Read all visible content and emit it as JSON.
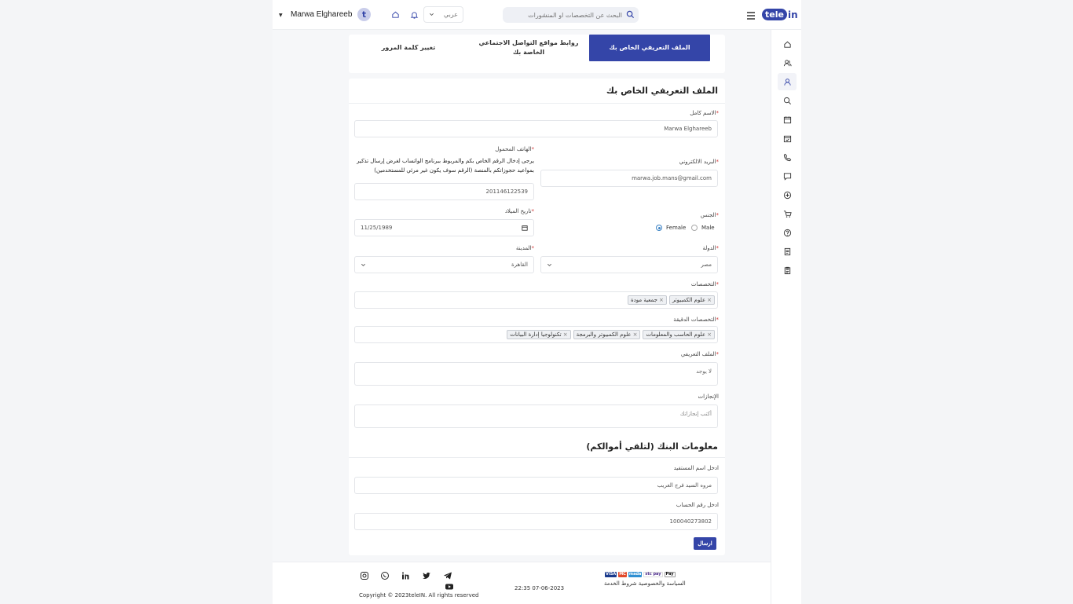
{
  "header": {
    "logo_tele": "tele",
    "logo_in": "in",
    "search_placeholder": "البحث عن التخصصات او المنشورات",
    "language": "عربي",
    "avatar_letter": "t",
    "username": "Marwa Elghareeb"
  },
  "tabs": [
    {
      "label": "الملف التعريفي الخاص بك",
      "active": true
    },
    {
      "label": "روابط مواقع التواصل الاجتماعي الخاصة بك",
      "active": false
    },
    {
      "label": "تغيير كلمة المرور",
      "active": false
    }
  ],
  "profile": {
    "title": "الملف التعريفي الخاص بك",
    "full_name_label": "الاسم كامل",
    "full_name": "Marwa Elghareeb",
    "mobile_label": "الهاتف المحمول",
    "mobile_note": "يرجى إدخال الرقم الخاص بكم والمربوط ببرنامج الواتساب لغرض إرسال تذكير بمواعيد حجوزاتكم بالمنصة (الرقم سوف يكون غير مرئي للمستخدمين)",
    "mobile": "201146122539",
    "email_label": "البريد الالكتروني",
    "email": "marwa.job.mans@gmail.com",
    "birthdate_label": "تاريخ الميلاد",
    "birthdate": "11/25/1989",
    "gender_label": "الجنس",
    "gender_female": "Female",
    "gender_male": "Male",
    "gender_selected": "Female",
    "city_label": "المدينة",
    "city": "القاهرة",
    "country_label": "الدولة",
    "country": "مصر",
    "specialties_label": "التخصصات",
    "specialties": [
      "علوم الكمبيوتر",
      "جمعية مودة"
    ],
    "sub_specialties_label": "التخصصات الدقيقة",
    "sub_specialties": [
      "علوم الحاسب والمعلومات",
      "علوم الكمبيوتر والبرمجة",
      "تكنولوجيا إدارة البيانات"
    ],
    "bio_label": "الملف التعريفي",
    "bio": "لا يوجد",
    "achievements_label": "الإنجازات",
    "achievements_placeholder": "أكتب إنجازاتك"
  },
  "bank": {
    "title": "معلومات البنك (لتلقي أموالكم)",
    "beneficiary_label": "ادخل اسم المستفيد",
    "beneficiary": "مروه السيد فرج الغريب",
    "account_label": "ادخل رقم الحساب",
    "account": "100040273802",
    "submit": "ارسال"
  },
  "footer": {
    "copyright": "Copyright © 2023teleIN. All rights reserved",
    "datetime": "22:35 07-06-2023",
    "policy": "السياسة والخصوصية شروط الخدمة",
    "payments": [
      "VISA",
      "MC",
      "mada",
      "stc pay",
      "Pay"
    ]
  },
  "sidebar_icons": [
    "home-icon",
    "users-icon",
    "user-icon",
    "search-icon",
    "calendar-icon",
    "calendar-check-icon",
    "phone-icon",
    "chat-icon",
    "plus-circle-icon",
    "cart-icon",
    "help-icon",
    "document-icon",
    "clipboard-icon"
  ],
  "colors": {
    "primary": "#3445a8",
    "required": "#d23c3c"
  }
}
